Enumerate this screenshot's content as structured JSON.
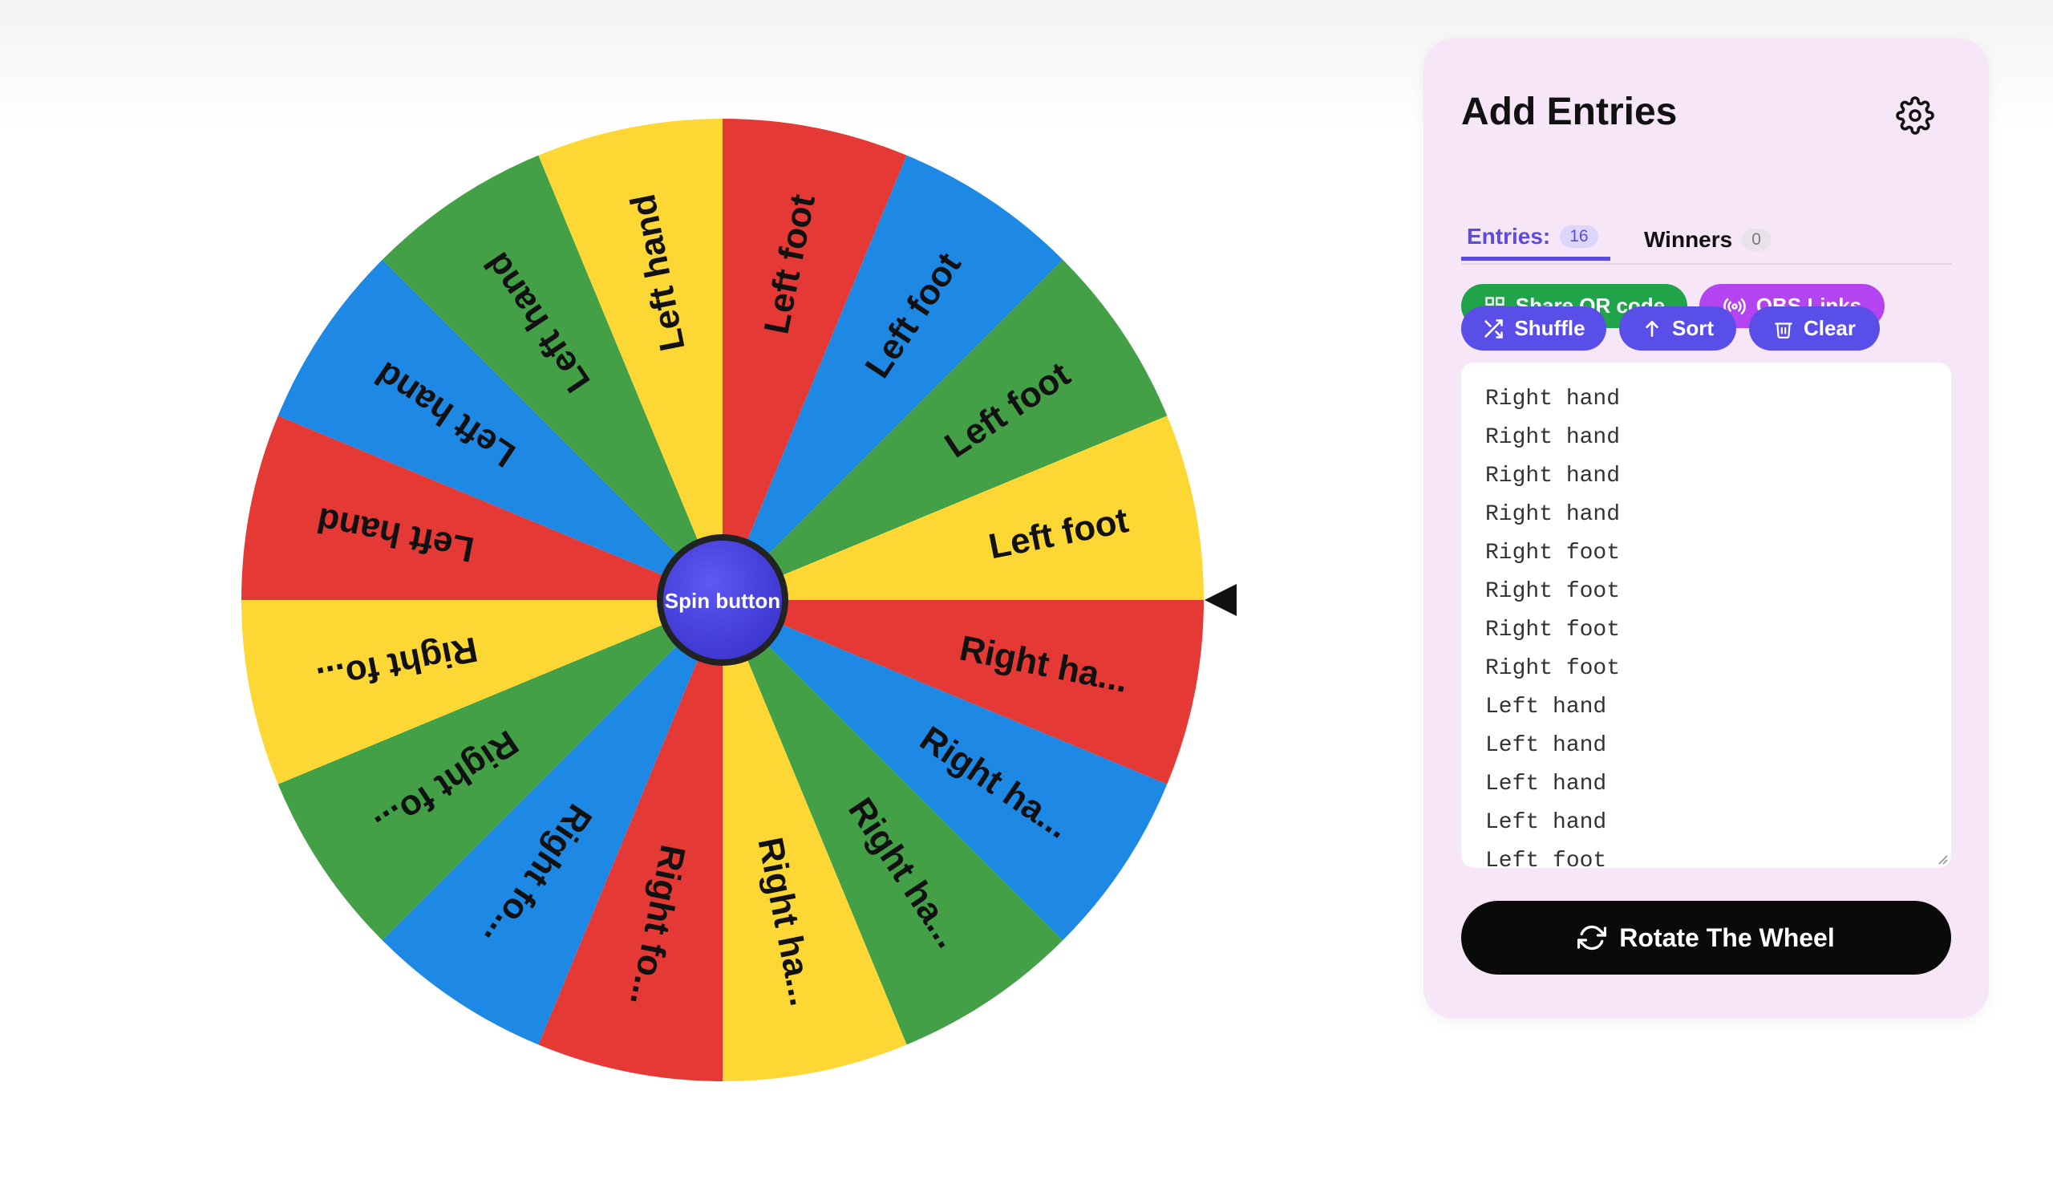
{
  "wheel": {
    "spin_button_label": "Spin button",
    "pointer_icon": "triangle-pointer-icon",
    "segments": [
      {
        "label": "Right ha...",
        "color": "#e53935"
      },
      {
        "label": "Right ha...",
        "color": "#1e88e5"
      },
      {
        "label": "Right ha...",
        "color": "#43a047"
      },
      {
        "label": "Right ha...",
        "color": "#fdd835"
      },
      {
        "label": "Right fo...",
        "color": "#e53935"
      },
      {
        "label": "Right fo...",
        "color": "#1e88e5"
      },
      {
        "label": "Right fo...",
        "color": "#43a047"
      },
      {
        "label": "Right fo...",
        "color": "#fdd835"
      },
      {
        "label": "Left hand",
        "color": "#e53935"
      },
      {
        "label": "Left hand",
        "color": "#1e88e5"
      },
      {
        "label": "Left hand",
        "color": "#43a047"
      },
      {
        "label": "Left hand",
        "color": "#fdd835"
      },
      {
        "label": "Left foot",
        "color": "#e53935"
      },
      {
        "label": "Left foot",
        "color": "#1e88e5"
      },
      {
        "label": "Left foot",
        "color": "#43a047"
      },
      {
        "label": "Left foot",
        "color": "#fdd835"
      }
    ]
  },
  "panel": {
    "title": "Add Entries",
    "settings_icon": "gear-icon",
    "tabs": [
      {
        "label": "Entries:",
        "count": "16"
      },
      {
        "label": "Winners",
        "count": "0"
      }
    ],
    "buttons": {
      "share_qr": "Share QR code",
      "obs_links": "OBS Links",
      "shuffle": "Shuffle",
      "sort": "Sort",
      "clear": "Clear"
    },
    "entries": [
      "Right hand",
      "Right hand",
      "Right hand",
      "Right hand",
      "Right foot",
      "Right foot",
      "Right foot",
      "Right foot",
      "Left hand",
      "Left hand",
      "Left hand",
      "Left hand",
      "Left foot",
      "Left foot",
      "Left foot",
      "Left foot"
    ],
    "rotate_label": "Rotate The Wheel"
  },
  "colors": {
    "accent": "#5a4ee8",
    "share_green": "#21a34a",
    "obs_purple": "#b443f0",
    "panel_bg": "#f7e6f7"
  }
}
